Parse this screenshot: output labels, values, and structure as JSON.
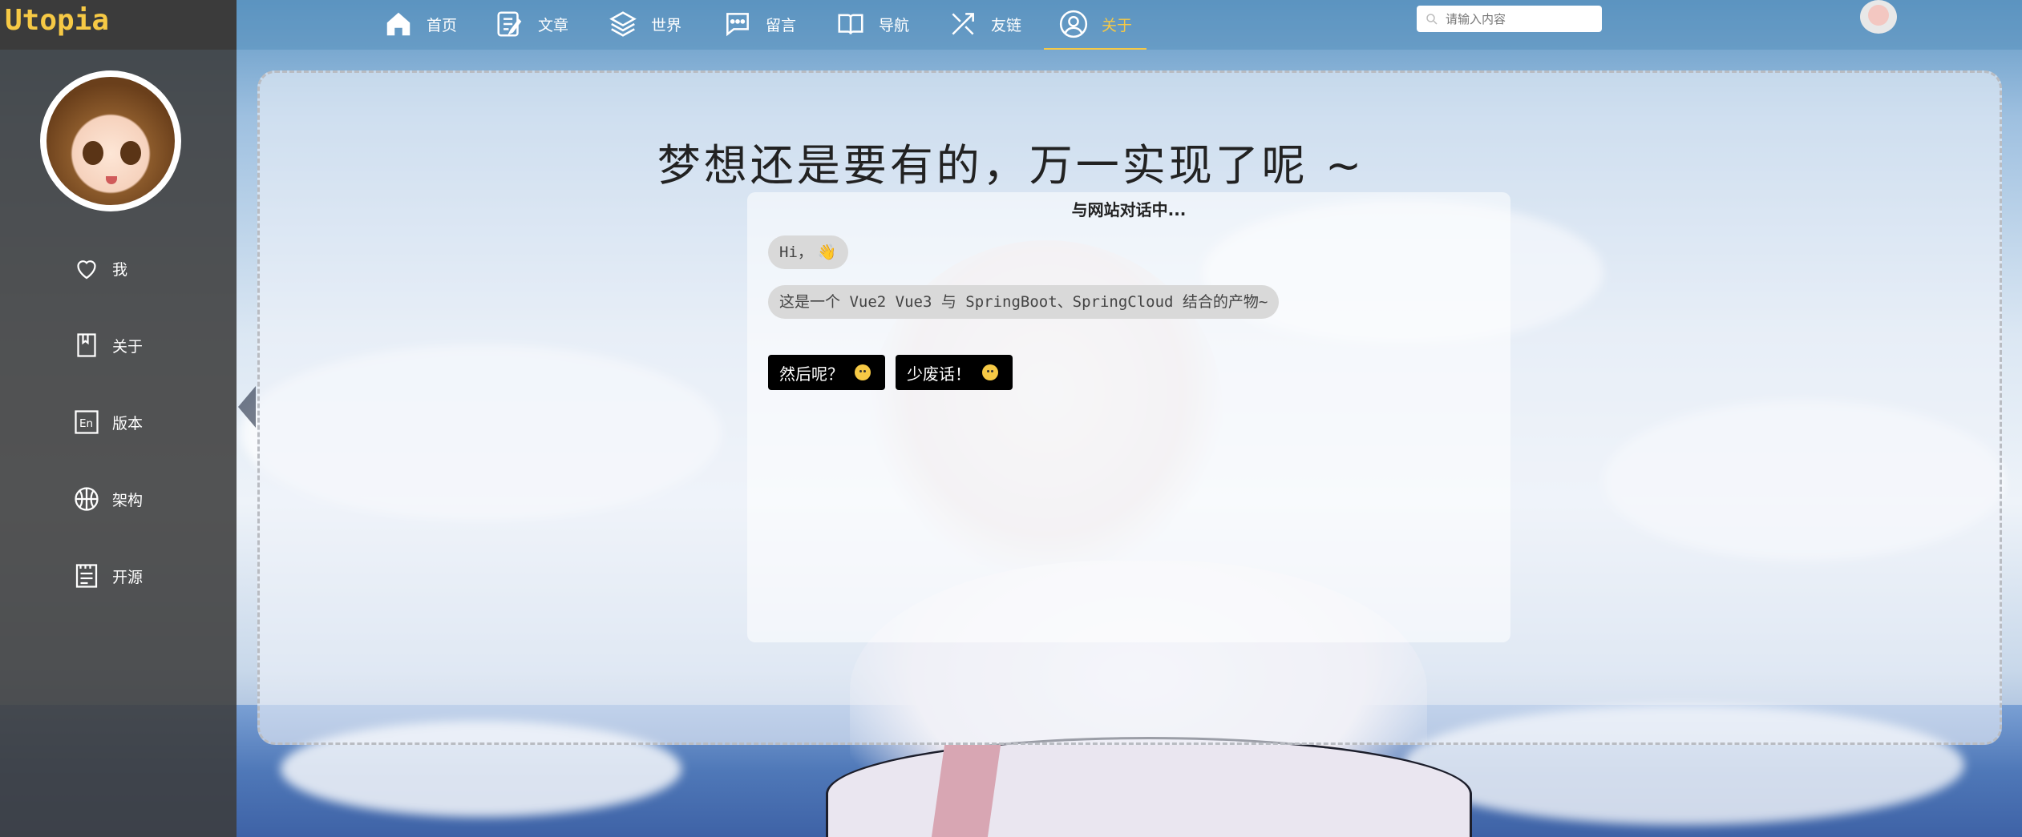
{
  "brand": {
    "title": "Utopia",
    "color": "#f6c945"
  },
  "sidebar": {
    "items": [
      {
        "label": "我",
        "icon": "heart-icon"
      },
      {
        "label": "关于",
        "icon": "book-icon"
      },
      {
        "label": "版本",
        "icon": "en-icon"
      },
      {
        "label": "架构",
        "icon": "basketball-icon"
      },
      {
        "label": "开源",
        "icon": "notebook-icon"
      }
    ]
  },
  "nav": {
    "items": [
      {
        "label": "首页",
        "icon": "home-icon"
      },
      {
        "label": "文章",
        "icon": "edit-icon"
      },
      {
        "label": "世界",
        "icon": "layers-icon"
      },
      {
        "label": "留言",
        "icon": "message-icon"
      },
      {
        "label": "导航",
        "icon": "open-book-icon"
      },
      {
        "label": "友链",
        "icon": "tools-icon"
      },
      {
        "label": "关于",
        "icon": "user-circle-icon",
        "active": true
      }
    ],
    "active_color": "#f6c945"
  },
  "search": {
    "placeholder": "请输入内容"
  },
  "main": {
    "headline": "梦想还是要有的，万一实现了呢 ~",
    "chat": {
      "title": "与网站对话中...",
      "messages": [
        "Hi，",
        "这是一个 Vue2 Vue3 与 SpringBoot、SpringCloud 结合的产物~"
      ],
      "buttons": [
        "然后呢？",
        "少废话！"
      ]
    }
  }
}
